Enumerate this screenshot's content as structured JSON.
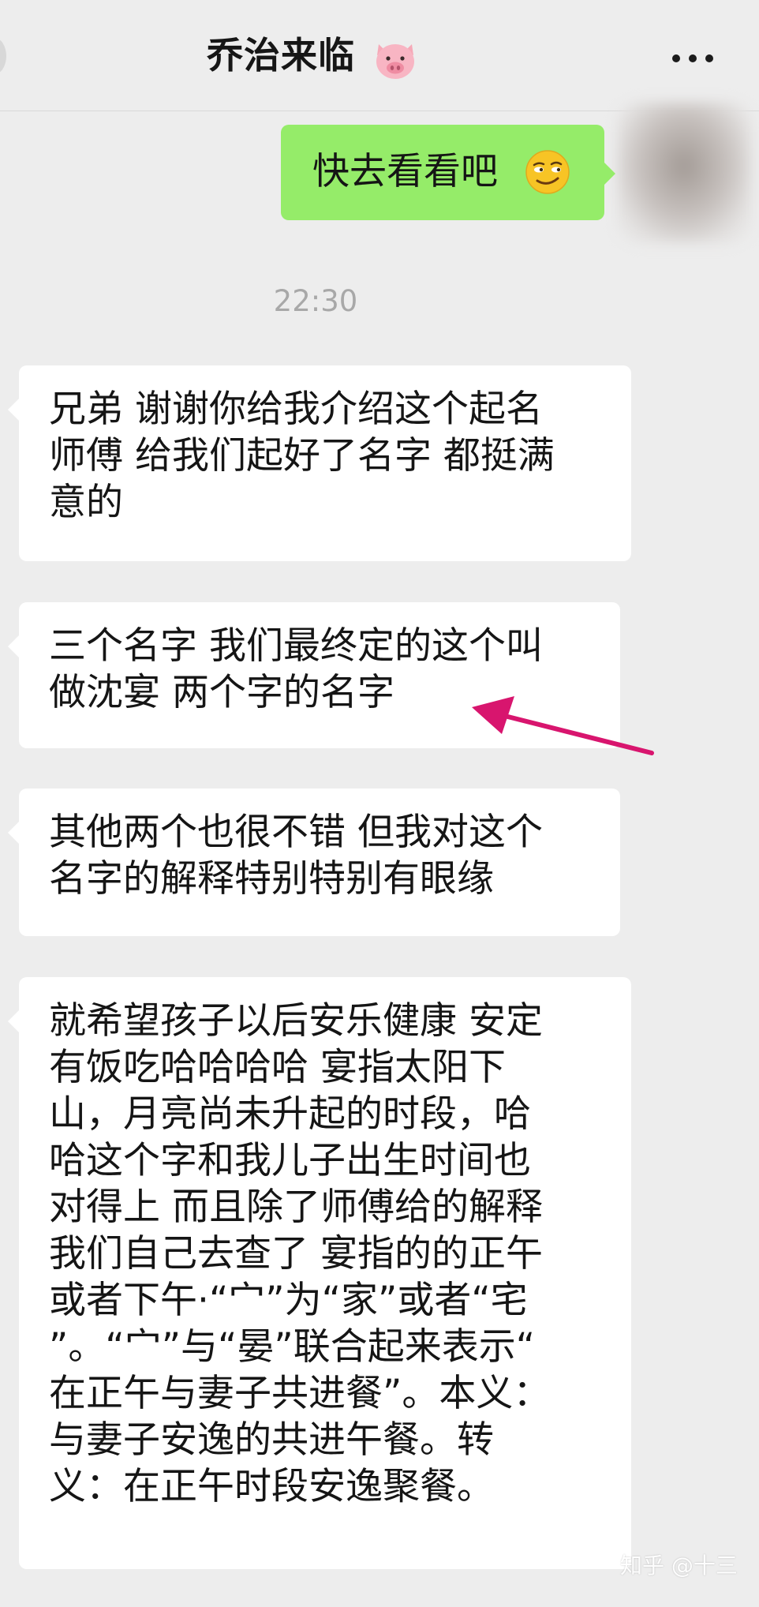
{
  "header": {
    "title": "乔治来临",
    "title_icon": "pig-face-icon",
    "menu_icon": "more-dots-icon"
  },
  "messages": [
    {
      "side": "right",
      "text": "快去看看吧",
      "icon": "smirking-face-icon"
    },
    {
      "side": "left",
      "lines": [
        "兄弟 谢谢你给我介绍这个起名",
        "师傅 给我们起好了名字 都挺满",
        "意的"
      ]
    },
    {
      "side": "left",
      "lines": [
        "三个名字 我们最终定的这个叫",
        "做沈宴 两个字的名字"
      ]
    },
    {
      "side": "left",
      "lines": [
        "其他两个也很不错 但我对这个",
        "名字的解释特别特别有眼缘"
      ]
    },
    {
      "side": "left",
      "lines": [
        "就希望孩子以后安乐健康 安定",
        "有饭吃哈哈哈哈 宴指太阳下",
        "山，月亮尚未升起的时段，哈",
        "哈这个字和我儿子出生时间也",
        "对得上 而且除了师傅给的解释",
        "我们自己去查了 宴指的的正午",
        "或者下午·“宀”为“家”或者“宅",
        "”。“宀”与“晏”联合起来表示“",
        "在正午与妻子共进餐”。本义：",
        "与妻子安逸的共进午餐。转",
        "义：在正午时段安逸聚餐。"
      ]
    }
  ],
  "timestamp": "22:30",
  "annotation": {
    "arrow_color": "#d8156e"
  },
  "watermark": "知乎 @十三",
  "colors": {
    "background": "#ededed",
    "sent_bubble": "#95ec69",
    "received_bubble": "#ffffff"
  }
}
